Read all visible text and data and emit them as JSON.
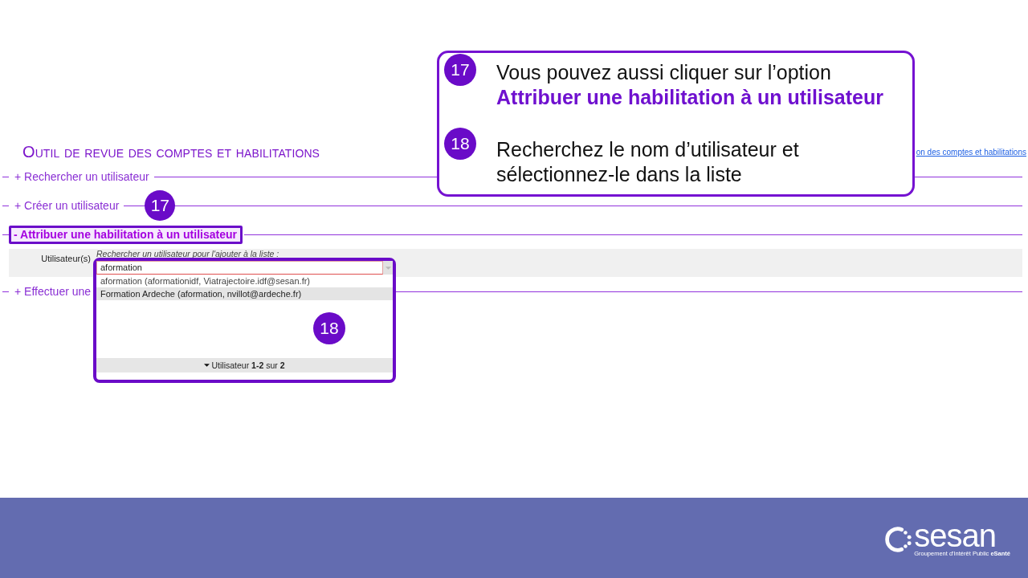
{
  "page": {
    "title": "Outil de revue des comptes et habilitations",
    "link": "on des comptes et habilitations"
  },
  "sections": [
    {
      "label": "+ Rechercher un utilisateur",
      "expanded": false,
      "highlighted": false
    },
    {
      "label": "+ Créer un utilisateur",
      "expanded": false,
      "highlighted": false,
      "step": "17"
    },
    {
      "label": "- Attribuer une habilitation à un utilisateur",
      "expanded": true,
      "highlighted": true,
      "form": {
        "field_label": "Utilisateur(s)",
        "hint": "Rechercher un utilisateur pour l'ajouter à la liste :",
        "search": {
          "value": "aformation",
          "highlighted": true,
          "step": "18",
          "results": [
            {
              "text": "aformation (aformationidf, Viatrajectoire.idf@sesan.fr)",
              "selected": false
            },
            {
              "text": "Formation Ardeche (aformation, nvillot@ardeche.fr)",
              "selected": true
            }
          ],
          "pager": "Utilisateur **1-2** sur **2**"
        }
      }
    },
    {
      "label": "+ Effectuer une",
      "expanded": false,
      "highlighted": false
    }
  ],
  "callout": {
    "steps": [
      {
        "number": "17",
        "text": "Vous pouvez aussi cliquer sur l’option **Attribuer une habilitation à un utilisateur**"
      },
      {
        "number": "18",
        "text": "Recherchez le nom d’utilisateur et sélectionnez-le dans la liste"
      }
    ]
  },
  "footer": {
    "brand": "sesan",
    "tagline": "Groupement d'Intérêt Public **eSanté**"
  }
}
